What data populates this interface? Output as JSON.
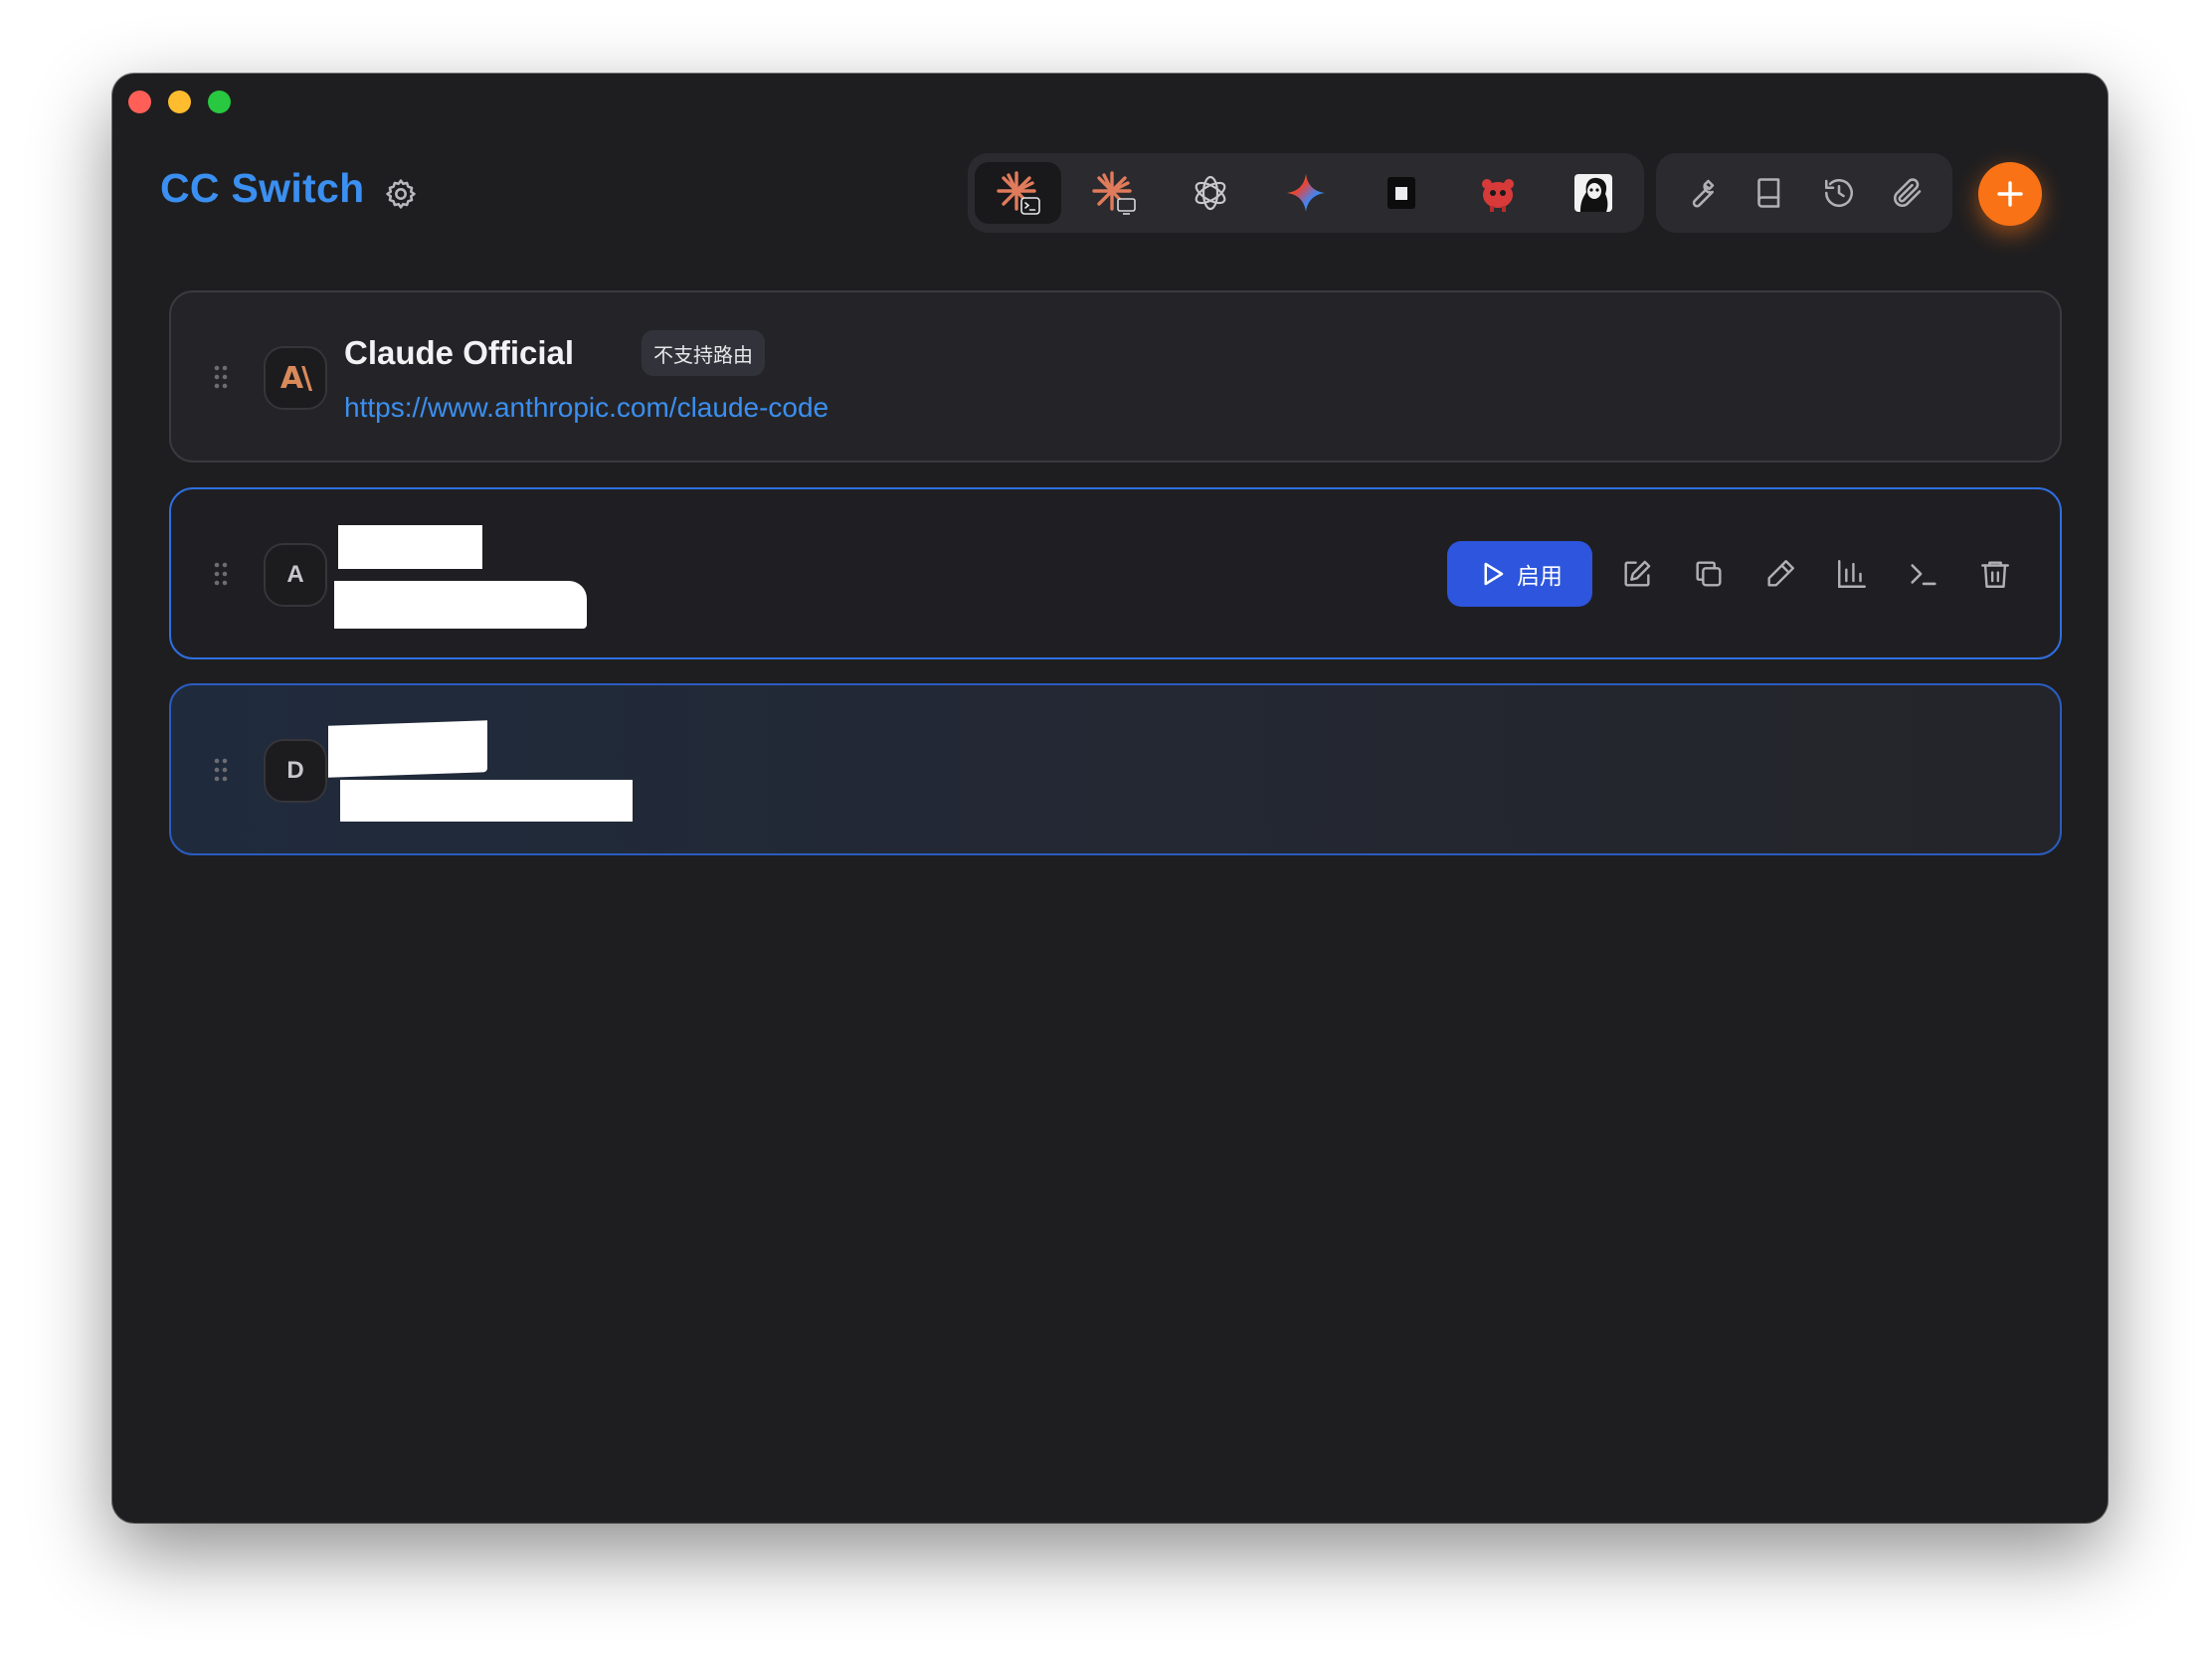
{
  "app": {
    "title": "CC Switch"
  },
  "app_switcher": [
    {
      "name": "claude-code",
      "active": true
    },
    {
      "name": "claude-desktop",
      "active": false
    },
    {
      "name": "openai-codex",
      "active": false
    },
    {
      "name": "gemini",
      "active": false
    },
    {
      "name": "terminal-app",
      "active": false
    },
    {
      "name": "red-mascot-app",
      "active": false
    },
    {
      "name": "portrait-app",
      "active": false
    }
  ],
  "toolbar": [
    "wrench-icon",
    "book-icon",
    "history-icon",
    "paperclip-icon"
  ],
  "colors": {
    "accent": "#3b8ff0",
    "add_button": "#f97316",
    "enable_button": "#2d55dd"
  },
  "providers": [
    {
      "name": "Claude Official",
      "badge": "不支持路由",
      "url": "https://www.anthropic.com/claude-code",
      "avatar": "A\\"
    },
    {
      "avatar": "A",
      "enable_label": "启用"
    },
    {
      "avatar": "D"
    }
  ]
}
